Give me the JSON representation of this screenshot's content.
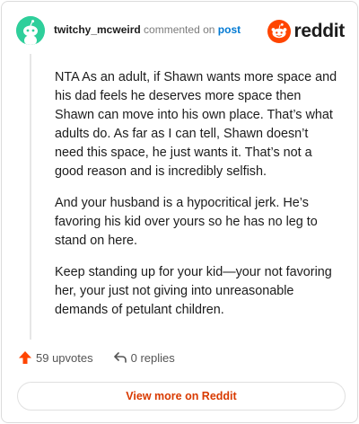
{
  "comment": {
    "username": "twitchy_mcweird",
    "action_text": "commented on",
    "post_link": "post",
    "paragraphs": [
      "NTA As an adult, if Shawn wants more space and his dad feels he deserves more space then Shawn can move into his own place. That’s what adults do. As far as I can tell, Shawn doesn’t need this space, he just wants it. That’s not a good reason and is incredibly selfish.",
      "And your husband is a hypocritical jerk. He’s favoring his kid over yours so he has no leg to stand on here.",
      "Keep standing up for your kid—your not favoring her, your just not giving into unreasonable demands of petulant children."
    ],
    "upvotes": "59 upvotes",
    "replies": "0 replies"
  },
  "brand": {
    "wordmark": "reddit",
    "color": "#ff4500"
  },
  "cta": {
    "view_more": "View more on Reddit"
  },
  "icons": {
    "upvote": "upvote-arrow-icon",
    "reply": "reply-icon",
    "avatar": "snoo-avatar-icon",
    "logo": "reddit-snoo-icon"
  },
  "colors": {
    "accent": "#ff4500",
    "avatar_bg": "#2fcf9b",
    "link": "#0079d3",
    "cta_text": "#d93a00"
  }
}
